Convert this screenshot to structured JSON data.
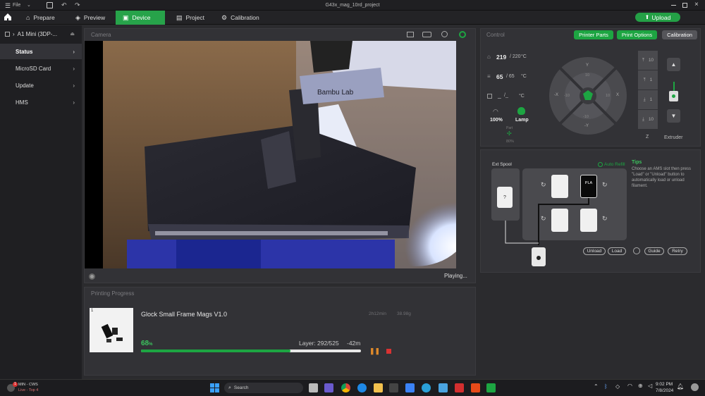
{
  "titlebar": {
    "file_label": "File",
    "title": "G43x_mag_10rd_project"
  },
  "nav": {
    "tabs": [
      {
        "label": "Prepare"
      },
      {
        "label": "Preview"
      },
      {
        "label": "Device"
      },
      {
        "label": "Project"
      },
      {
        "label": "Calibration"
      }
    ],
    "active_tab": "Device",
    "upload_label": "Upload"
  },
  "sidebar": {
    "device_name": "A1 Mini (3DP-...",
    "items": [
      {
        "label": "Status"
      },
      {
        "label": "MicroSD Card"
      },
      {
        "label": "Update"
      },
      {
        "label": "HMS"
      }
    ]
  },
  "camera": {
    "title": "Camera",
    "status": "Playing...",
    "bed_label": "Bambu Lab"
  },
  "progress": {
    "title": "Printing Progress",
    "plate_number": "1",
    "job_name": "Glock Small Frame Mags V1.0",
    "time_estimate": "2h12min",
    "weight": "38.98g",
    "percent": "68",
    "percent_unit": "%",
    "percent_value": 68,
    "layer_text": "Layer: 292/525",
    "remaining": "-42m"
  },
  "control": {
    "title": "Control",
    "buttons": {
      "printer_parts": "Printer Parts",
      "print_options": "Print Options",
      "calibration": "Calibration"
    },
    "nozzle_temp": "219",
    "nozzle_target": "/ 220",
    "bed_temp": "65",
    "bed_target": "/ 65",
    "chamber_temp": "_",
    "chamber_target": "/_",
    "temp_unit": "°C",
    "speed": "100%",
    "lamp": "Lamp",
    "fan_label": "Part",
    "fan_value": "80%",
    "jog": {
      "y_plus": "Y",
      "y_minus": "-Y",
      "x_plus": "X",
      "x_minus": "-X",
      "y10": "10",
      "y_10": "-10",
      "x10": "10",
      "x_10": "-10"
    },
    "z_steps": [
      "10",
      "1",
      "1",
      "10"
    ],
    "z_label": "Z",
    "extruder_label": "Extruder"
  },
  "ams": {
    "ext_spool_label": "Ext Spool",
    "ext_spool_value": "?",
    "auto_refill": "Auto Refill",
    "tips_title": "Tips",
    "tips_text": "Choose an AMS slot then press \"Load\" or \"Unload\" button to automatically load or unload filament.",
    "active_slot_material": "PLA",
    "buttons": {
      "unload": "Unload",
      "load": "Load",
      "guide": "Guide",
      "retry": "Retry"
    }
  },
  "taskbar": {
    "notification_line1": "MIN - CWS",
    "notification_line2": "Live - Top 4",
    "notification_badge": "1",
    "search_placeholder": "Search",
    "time": "9:02 PM",
    "date": "7/8/2024"
  },
  "colors": {
    "accent_green": "#1da542",
    "panel_bg": "#323236",
    "sidebar_bg": "#1f1f22"
  }
}
